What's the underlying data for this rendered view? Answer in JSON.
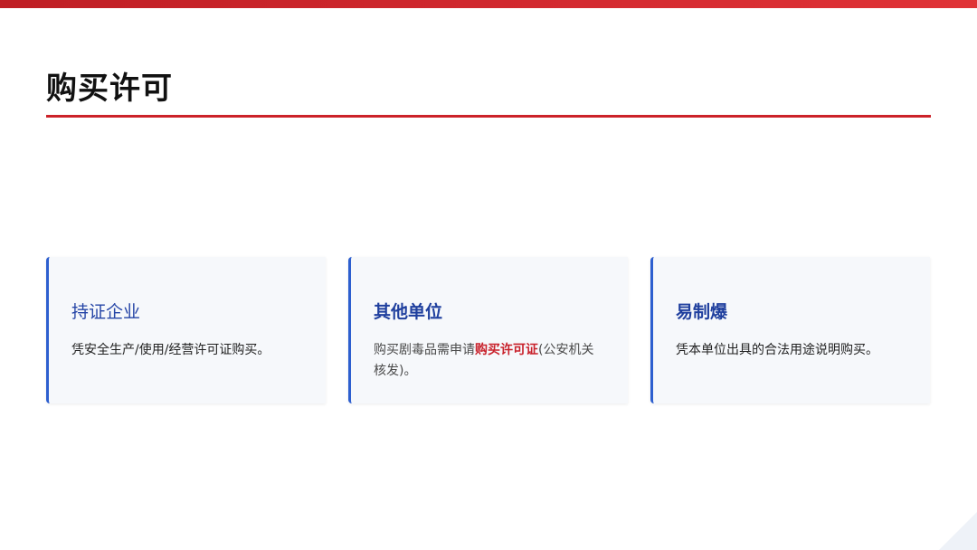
{
  "slide": {
    "title": "购买许可"
  },
  "cards": [
    {
      "heading": "持证企业",
      "body": "凭安全生产/使用/经营许可证购买。"
    },
    {
      "heading": "其他单位",
      "body_before": "购买剧毒品需申请",
      "body_emphasis": "购买许可证",
      "body_after": "(公安机关核发)。"
    },
    {
      "heading": "易制爆",
      "body": "凭本单位出具的合法用途说明购买。"
    }
  ],
  "colors": {
    "accent_red": "#cc2229",
    "accent_blue": "#2d5fcf",
    "heading_blue": "#1f3f9e"
  }
}
